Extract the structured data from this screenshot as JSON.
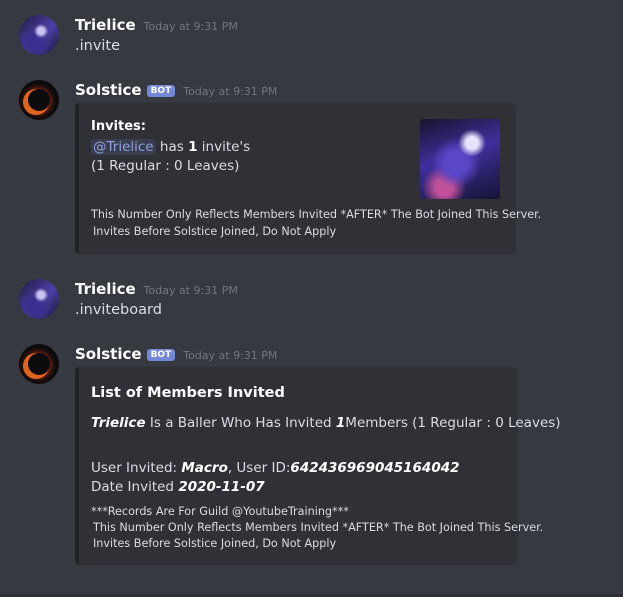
{
  "messages": [
    {
      "author": "Trielice",
      "timestamp": "Today at 9:31 PM",
      "text": ".invite"
    },
    {
      "author": "Solstice",
      "bot_tag": "BOT",
      "timestamp": "Today at 9:31 PM",
      "embed": {
        "title": "Invites:",
        "mention": "@Trielice",
        "text_has": "has",
        "invite_count": "1",
        "text_invites": "invite's",
        "breakdown": "(1 Regular : 0 Leaves)",
        "footer_line1": "This Number Only Reflects Members Invited *AFTER* The Bot Joined This Server.",
        "footer_line2": "Invites Before Solstice Joined, Do Not Apply"
      }
    },
    {
      "author": "Trielice",
      "timestamp": "Today at 9:31 PM",
      "text": ".inviteboard"
    },
    {
      "author": "Solstice",
      "bot_tag": "BOT",
      "timestamp": "Today at 9:31 PM",
      "embed": {
        "title": "List of Members Invited",
        "inviter": "Trielice",
        "text_baller": "Is a Baller Who Has Invited",
        "invited_count": "1",
        "text_members": "Members (1 Regular : 0 Leaves)",
        "user_invited_label": "User Invited:",
        "user_invited_name": "Macro",
        "user_id_label": ", User ID:",
        "user_id": "642436969045164042",
        "date_invited_label": "Date Invited",
        "date_invited": "2020-11-07",
        "footer_line1": "***Records Are For Guild @YoutubeTraining***",
        "footer_line2": "This Number Only Reflects Members Invited *AFTER* The Bot Joined This Server.",
        "footer_line3": "Invites Before Solstice Joined, Do Not Apply"
      }
    }
  ]
}
